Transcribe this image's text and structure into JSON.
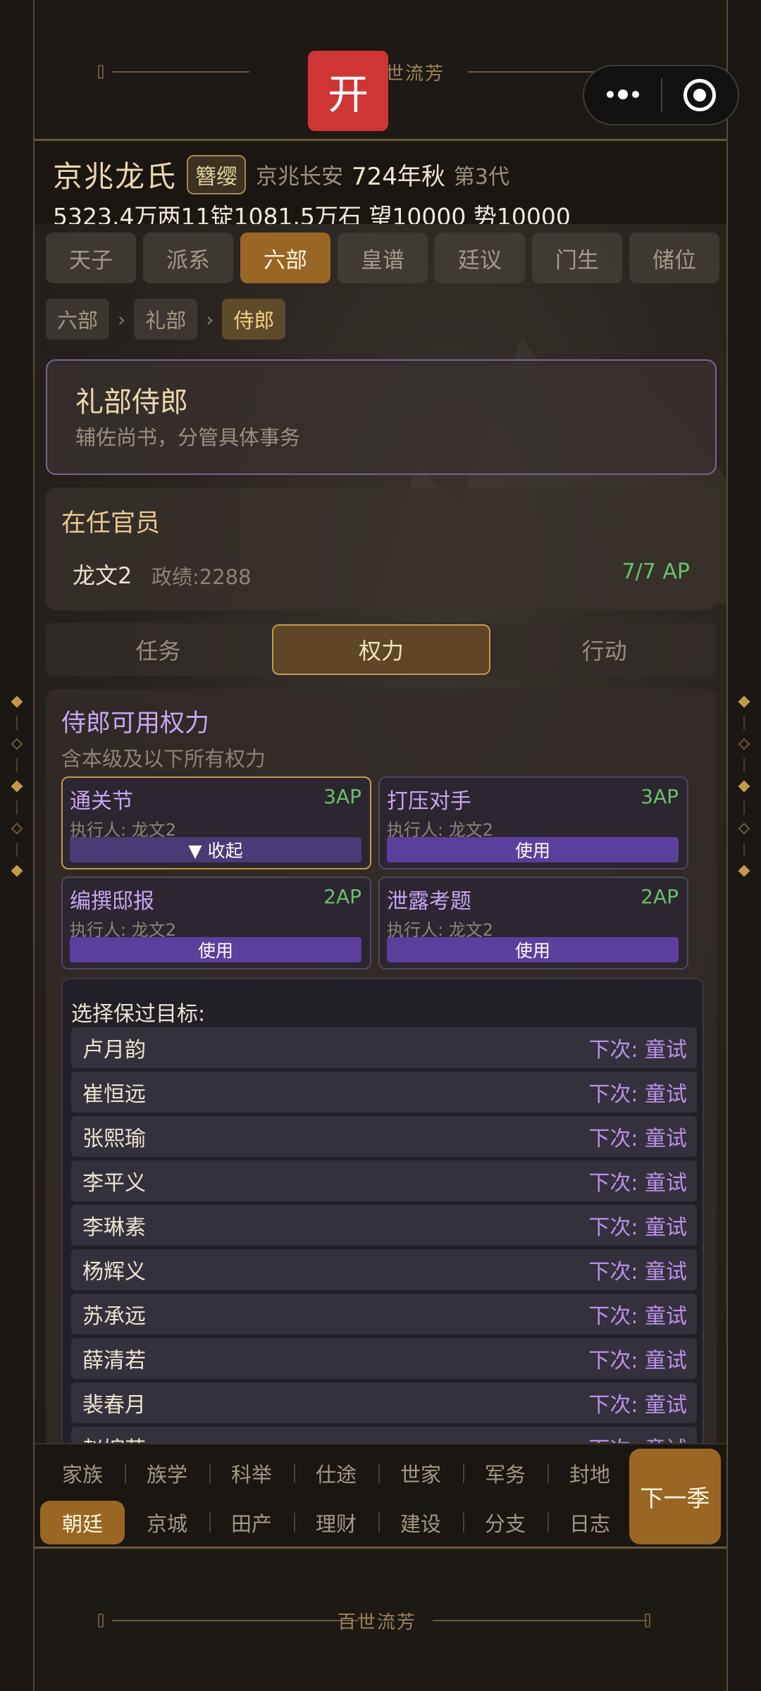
{
  "app": {
    "title": "百世流芳",
    "icon_char": "开"
  },
  "header": {
    "family": "京兆龙氏",
    "rank": "簪缨",
    "place": "京兆长安",
    "year": "724年秋",
    "generation": "第3代",
    "resources": "5323.4万两11锭1081.5万石  望10000 势10000"
  },
  "tabs": [
    "天子",
    "派系",
    "六部",
    "皇谱",
    "廷议",
    "门生",
    "储位"
  ],
  "active_tab": "六部",
  "breadcrumb": [
    "六部",
    "礼部",
    "侍郎"
  ],
  "office": {
    "title": "礼部侍郎",
    "desc": "辅佐尚书，分管具体事务"
  },
  "incumbent": {
    "title": "在任官员",
    "name": "龙文2",
    "stats": "政绩:2288",
    "ap": "7/7 AP"
  },
  "subtabs": [
    "任务",
    "权力",
    "行动"
  ],
  "powers": {
    "title": "侍郎可用权力",
    "desc": "含本级及以下所有权力",
    "cards": [
      {
        "name": "通关节",
        "ap": "3AP",
        "executor": "执行人: 龙文2",
        "button": "▼ 收起"
      },
      {
        "name": "打压对手",
        "ap": "3AP",
        "executor": "执行人: 龙文2",
        "button": "使用"
      },
      {
        "name": "编撰邸报",
        "ap": "2AP",
        "executor": "执行人: 龙文2",
        "button": "使用"
      },
      {
        "name": "泄露考题",
        "ap": "2AP",
        "executor": "执行人: 龙文2",
        "button": "使用"
      }
    ],
    "targets_title": "选择保过目标:",
    "targets": [
      {
        "name": "卢月韵",
        "next": "下次: 童试"
      },
      {
        "name": "崔恒远",
        "next": "下次: 童试"
      },
      {
        "name": "张熙瑜",
        "next": "下次: 童试"
      },
      {
        "name": "李平义",
        "next": "下次: 童试"
      },
      {
        "name": "李琳素",
        "next": "下次: 童试"
      },
      {
        "name": "杨辉义",
        "next": "下次: 童试"
      },
      {
        "name": "苏承远",
        "next": "下次: 童试"
      },
      {
        "name": "薛清若",
        "next": "下次: 童试"
      },
      {
        "name": "裴春月",
        "next": "下次: 童试"
      },
      {
        "name": "赵婉若",
        "next": "下次: 童试"
      }
    ]
  },
  "bottom_nav": {
    "row1": [
      "家族",
      "族学",
      "科举",
      "仕途",
      "世家",
      "军务",
      "封地"
    ],
    "row2": [
      "朝廷",
      "京城",
      "田产",
      "理财",
      "建设",
      "分支",
      "日志"
    ],
    "active": "朝廷",
    "next_button": "下一季"
  },
  "colors": {
    "accent": "#9a6624",
    "purple": "#5b3f9c",
    "green_ap": "#6bbf6b",
    "gold": "#c29a4a"
  }
}
